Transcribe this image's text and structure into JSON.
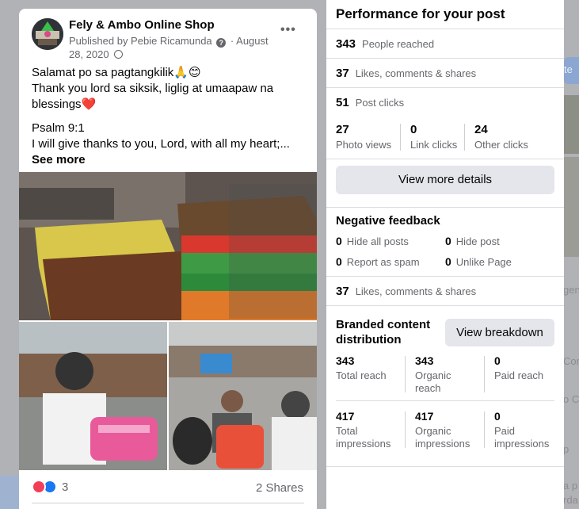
{
  "post": {
    "page_name": "Fely & Ambo Online Shop",
    "published_by": "Published by Pebie Ricamunda",
    "date": "August 28, 2020",
    "caption_line1": "Salamat po sa pagtangkilik🙏😊",
    "caption_line2": "Thank you lord sa siksik,  liglig at umaapaw na blessings❤️",
    "caption_line3": "Psalm 9:1",
    "caption_line4": "I will give thanks to you, Lord, with all my heart;...",
    "see_more": "See more",
    "reaction_count": "3",
    "shares": "2 Shares"
  },
  "performance": {
    "title": "Performance for your post",
    "people_reached": {
      "value": "343",
      "label": "People reached"
    },
    "engagement": {
      "value": "37",
      "label": "Likes, comments & shares"
    },
    "post_clicks": {
      "value": "51",
      "label": "Post clicks"
    },
    "clicks_breakdown": [
      {
        "value": "27",
        "label": "Photo views"
      },
      {
        "value": "0",
        "label": "Link clicks"
      },
      {
        "value": "24",
        "label": "Other clicks"
      }
    ],
    "view_details_label": "View more details"
  },
  "negative_feedback": {
    "title": "Negative feedback",
    "items": [
      {
        "value": "0",
        "label": "Hide all posts"
      },
      {
        "value": "0",
        "label": "Hide post"
      },
      {
        "value": "0",
        "label": "Report as spam"
      },
      {
        "value": "0",
        "label": "Unlike Page"
      }
    ],
    "engagement": {
      "value": "37",
      "label": "Likes, comments & shares"
    }
  },
  "branded_content": {
    "title_line1": "Branded content",
    "title_line2": "distribution",
    "view_breakdown_label": "View breakdown",
    "reach": [
      {
        "value": "343",
        "label": "Total reach"
      },
      {
        "value": "343",
        "label": "Organic reach"
      },
      {
        "value": "0",
        "label": "Paid reach"
      }
    ],
    "impressions": [
      {
        "value": "417",
        "label": "Total impressions"
      },
      {
        "value": "417",
        "label": "Organic impressions"
      },
      {
        "value": "0",
        "label": "Paid impressions"
      }
    ]
  },
  "background": {
    "button_fragment": "te",
    "text_fragments": [
      "gen",
      "Con",
      "o C",
      "p",
      "a p",
      "rda"
    ]
  },
  "colors": {
    "accent": "#1877f2",
    "love": "#f33e58",
    "button_grey": "#e4e6eb",
    "secondary_text": "#65676b"
  }
}
